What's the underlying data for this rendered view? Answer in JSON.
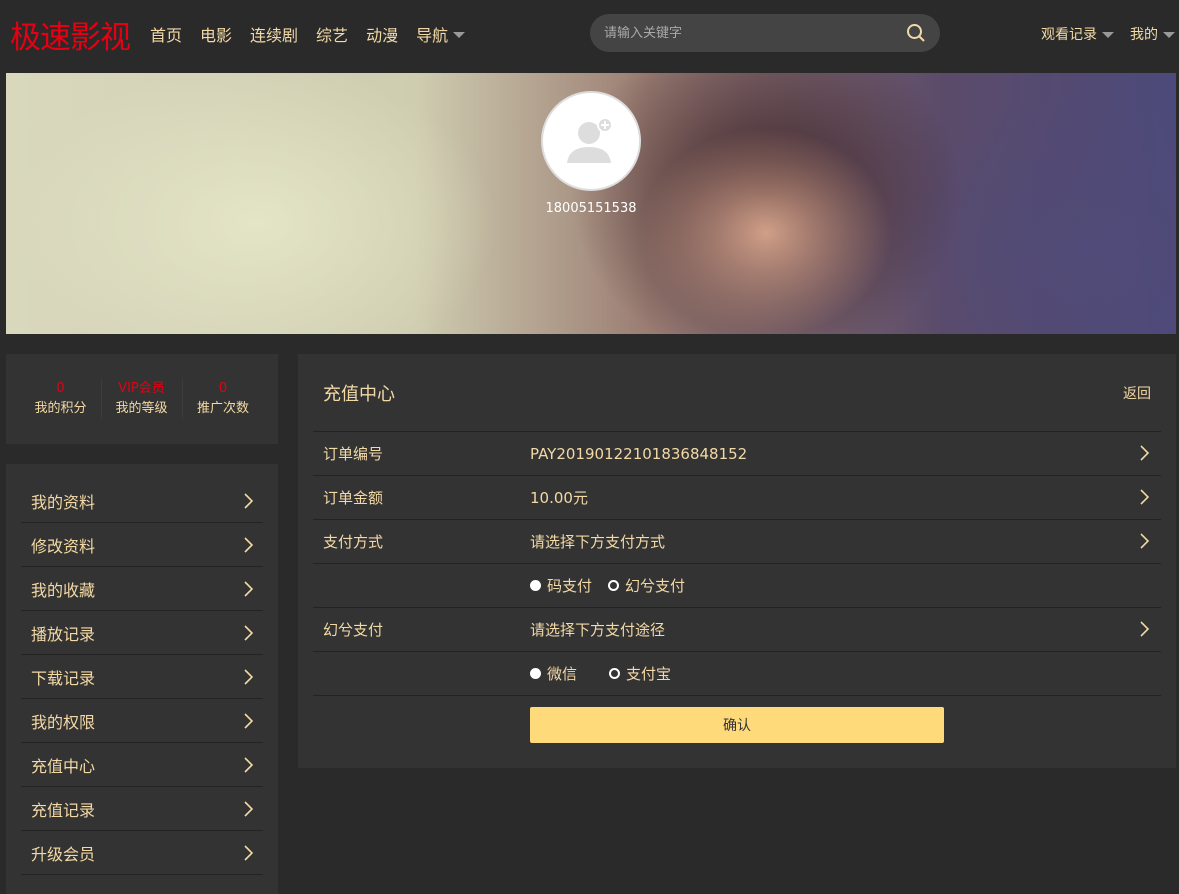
{
  "header": {
    "logo": "极速影视",
    "nav": [
      {
        "label": "首页"
      },
      {
        "label": "电影"
      },
      {
        "label": "连续剧"
      },
      {
        "label": "综艺"
      },
      {
        "label": "动漫"
      },
      {
        "label": "导航"
      }
    ],
    "search_placeholder": "请输入关键字",
    "watch_history": "观看记录",
    "mine": "我的"
  },
  "banner": {
    "username": "18005151538"
  },
  "stats": [
    {
      "value": "0",
      "label": "我的积分"
    },
    {
      "value": "VIP会员",
      "label": "我的等级"
    },
    {
      "value": "0",
      "label": "推广次数"
    }
  ],
  "menu": [
    {
      "label": "我的资料"
    },
    {
      "label": "修改资料"
    },
    {
      "label": "我的收藏"
    },
    {
      "label": "播放记录"
    },
    {
      "label": "下载记录"
    },
    {
      "label": "我的权限"
    },
    {
      "label": "充值中心"
    },
    {
      "label": "充值记录"
    },
    {
      "label": "升级会员"
    }
  ],
  "panel": {
    "title": "充值中心",
    "back": "返回",
    "order_no_label": "订单编号",
    "order_no": "PAY20190122101836848152",
    "amount_label": "订单金额",
    "amount": "10.00元",
    "pay_method_label": "支付方式",
    "pay_method_hint": "请选择下方支付方式",
    "pay_methods": [
      "码支付",
      "幻兮支付"
    ],
    "channel_label": "幻兮支付",
    "channel_hint": "请选择下方支付途径",
    "channels": [
      "微信",
      "支付宝"
    ],
    "confirm": "确认"
  },
  "colors": {
    "accent": "#f3d9a5",
    "brand": "#e60012",
    "button": "#ffda7a"
  }
}
